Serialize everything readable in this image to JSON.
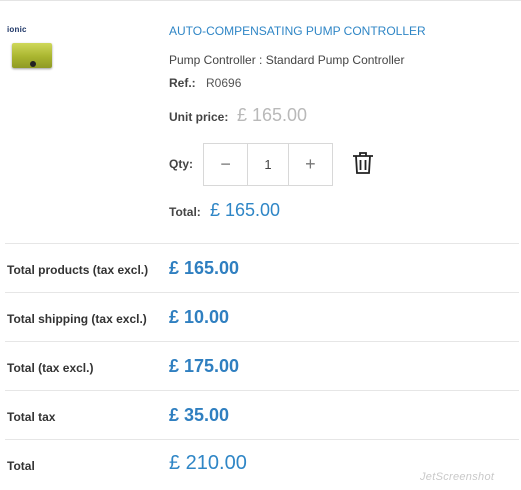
{
  "product": {
    "brand_logo": "ionic",
    "name": "AUTO-COMPENSATING PUMP CONTROLLER",
    "description": "Pump Controller : Standard Pump Controller",
    "ref_label": "Ref.:",
    "ref_value": "R0696",
    "unit_price_label": "Unit price:",
    "unit_price": "£ 165.00",
    "qty_label": "Qty:",
    "qty_value": "1",
    "qty_minus": "−",
    "qty_plus": "+",
    "total_label": "Total:",
    "total_value": "£ 165.00",
    "delete_icon": "trash-icon"
  },
  "summary": [
    {
      "label": "Total products (tax excl.)",
      "value": "£ 165.00"
    },
    {
      "label": "Total shipping (tax excl.)",
      "value": "£ 10.00"
    },
    {
      "label": "Total (tax excl.)",
      "value": "£ 175.00"
    },
    {
      "label": "Total tax",
      "value": "£ 35.00"
    },
    {
      "label": "Total",
      "value": "£ 210.00"
    }
  ],
  "watermark": "JetScreenshot",
  "colors": {
    "accent": "#2f86c6",
    "muted_price": "#b9b9b9",
    "divider": "#e6e6e6"
  }
}
